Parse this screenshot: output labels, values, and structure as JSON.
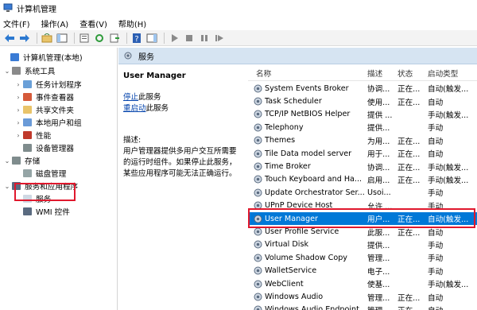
{
  "window": {
    "title": "计算机管理"
  },
  "menu": [
    "文件(F)",
    "操作(A)",
    "查看(V)",
    "帮助(H)"
  ],
  "tree": [
    {
      "label": "计算机管理(本地)",
      "exp": "",
      "icon": "computer-icon"
    },
    {
      "label": "系统工具",
      "exp": "v",
      "icon": "tools-icon"
    },
    {
      "label": "任务计划程序",
      "exp": ">",
      "icon": "clock-icon"
    },
    {
      "label": "事件查看器",
      "exp": ">",
      "icon": "event-viewer-icon"
    },
    {
      "label": "共享文件夹",
      "exp": ">",
      "icon": "shared-folder-icon"
    },
    {
      "label": "本地用户和组",
      "exp": ">",
      "icon": "users-icon"
    },
    {
      "label": "性能",
      "exp": ">",
      "icon": "performance-icon"
    },
    {
      "label": "设备管理器",
      "exp": "",
      "icon": "device-manager-icon"
    },
    {
      "label": "存储",
      "exp": "v",
      "icon": "storage-icon"
    },
    {
      "label": "磁盘管理",
      "exp": "",
      "icon": "disk-icon"
    },
    {
      "label": "服务和应用程序",
      "exp": "v",
      "icon": "services-apps-icon"
    },
    {
      "label": "服务",
      "exp": "",
      "icon": "services-icon"
    },
    {
      "label": "WMI 控件",
      "exp": "",
      "icon": "wmi-icon"
    }
  ],
  "content": {
    "header": "服务",
    "detail": {
      "title": "User Manager",
      "stop_link": "停止",
      "stop_suffix": "此服务",
      "restart_link": "重启动",
      "restart_suffix": "此服务",
      "desc_label": "描述:",
      "desc_body": "用户管理器提供多用户交互所需要的运行时组件。如果停止此服务，某些应用程序可能无法正确运行。"
    },
    "columns": {
      "name": "名称",
      "desc": "描述",
      "status": "状态",
      "start": "启动类型"
    },
    "rows": [
      {
        "name": "System Events Broker",
        "desc": "协调...",
        "status": "正在...",
        "start": "自动(触发..."
      },
      {
        "name": "Task Scheduler",
        "desc": "使用...",
        "status": "正在...",
        "start": "自动"
      },
      {
        "name": "TCP/IP NetBIOS Helper",
        "desc": "提供 ...",
        "status": "",
        "start": "手动(触发..."
      },
      {
        "name": "Telephony",
        "desc": "提供...",
        "status": "",
        "start": "手动"
      },
      {
        "name": "Themes",
        "desc": "为用...",
        "status": "正在...",
        "start": "自动"
      },
      {
        "name": "Tile Data model server",
        "desc": "用于...",
        "status": "正在...",
        "start": "自动"
      },
      {
        "name": "Time Broker",
        "desc": "协调...",
        "status": "正在...",
        "start": "手动(触发..."
      },
      {
        "name": "Touch Keyboard and Ha...",
        "desc": "启用...",
        "status": "正在...",
        "start": "手动(触发..."
      },
      {
        "name": "Update Orchestrator Ser...",
        "desc": "Usoi...",
        "status": "",
        "start": "手动"
      },
      {
        "name": "UPnP Device Host",
        "desc": "允许 ...",
        "status": "",
        "start": "手动"
      },
      {
        "name": "User Manager",
        "desc": "用户...",
        "status": "正在...",
        "start": "自动(触发..."
      },
      {
        "name": "User Profile Service",
        "desc": "此服...",
        "status": "正在...",
        "start": "自动"
      },
      {
        "name": "Virtual Disk",
        "desc": "提供...",
        "status": "",
        "start": "手动"
      },
      {
        "name": "Volume Shadow Copy",
        "desc": "管理...",
        "status": "",
        "start": "手动"
      },
      {
        "name": "WalletService",
        "desc": "电子...",
        "status": "",
        "start": "手动"
      },
      {
        "name": "WebClient",
        "desc": "使基...",
        "status": "",
        "start": "手动(触发..."
      },
      {
        "name": "Windows Audio",
        "desc": "管理...",
        "status": "正在...",
        "start": "自动"
      },
      {
        "name": "Windows Audio Endpoint...",
        "desc": "管理...",
        "status": "正在...",
        "start": "自动"
      }
    ],
    "selected_index": 10
  },
  "colors": {
    "header_bg": "#d6e4f2",
    "selection": "#0078d7",
    "highlight_box": "#e0182d",
    "link": "#0645ad"
  }
}
